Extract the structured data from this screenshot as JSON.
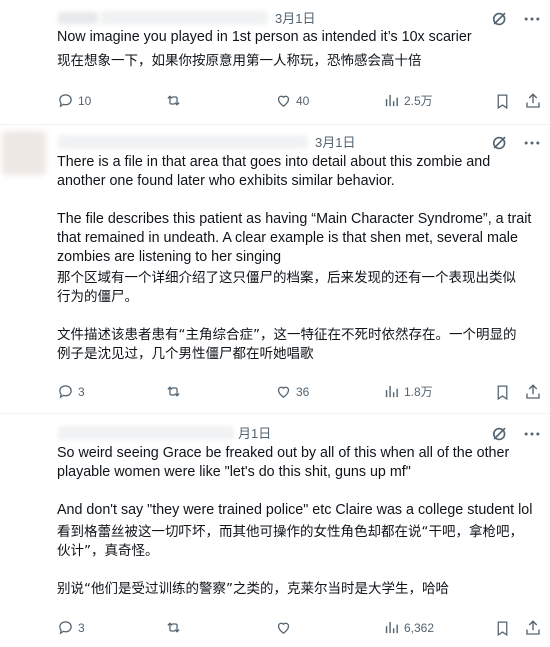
{
  "tweets": [
    {
      "date": "3月1日",
      "lines": [
        "Now imagine you played in 1st person as intended it’s 10x scarier",
        "现在想象一下，如果你按原意用第一人称玩，恐怖感会高十倍"
      ],
      "replies": "10",
      "retweets": "",
      "likes": "40",
      "views": "2.5万"
    },
    {
      "date": "3月1日",
      "lines": [
        "There is a file in that area that goes into detail about this zombie and",
        "another one found later who exhibits similar behavior.",
        "",
        "The file describes this patient as having “Main Character Syndrome”, a trait",
        "that remained in undeath. A clear example is that shen met, several male",
        "zombies are listening to her singing",
        "那个区域有一个详细介绍了这只僵尸的档案，后来发现的还有一个表现出类似",
        "行为的僵尸。",
        "",
        "文件描述该患者患有“主角综合症”，这一特征在不死时依然存在。一个明显的",
        "例子是沈见过，几个男性僵尸都在听她唱歌"
      ],
      "replies": "3",
      "retweets": "",
      "likes": "36",
      "views": "1.8万"
    },
    {
      "date": "月1日",
      "lines": [
        "So weird seeing Grace be freaked out by all of this when all of the other",
        "playable women were like \"let's do this shit, guns up mf\"",
        "",
        "And don't say \"they were trained police\" etc Claire was a college student lol",
        "看到格蕾丝被这一切吓坏，而其他可操作的女性角色却都在说“干吧，拿枪吧，",
        "伙计”，真奇怪。",
        "",
        "别说“他们是受过训练的警察”之类的，克莱尔当时是大学生，哈哈"
      ],
      "replies": "3",
      "retweets": "",
      "likes": "",
      "views": "6,362"
    }
  ],
  "colors": {
    "text": "#0f1419",
    "muted": "#536471",
    "divider": "#eff3f4"
  },
  "icons": [
    "reply-icon",
    "retweet-icon",
    "like-icon",
    "views-icon",
    "bookmark-icon",
    "share-icon",
    "grok-icon",
    "more-icon"
  ]
}
